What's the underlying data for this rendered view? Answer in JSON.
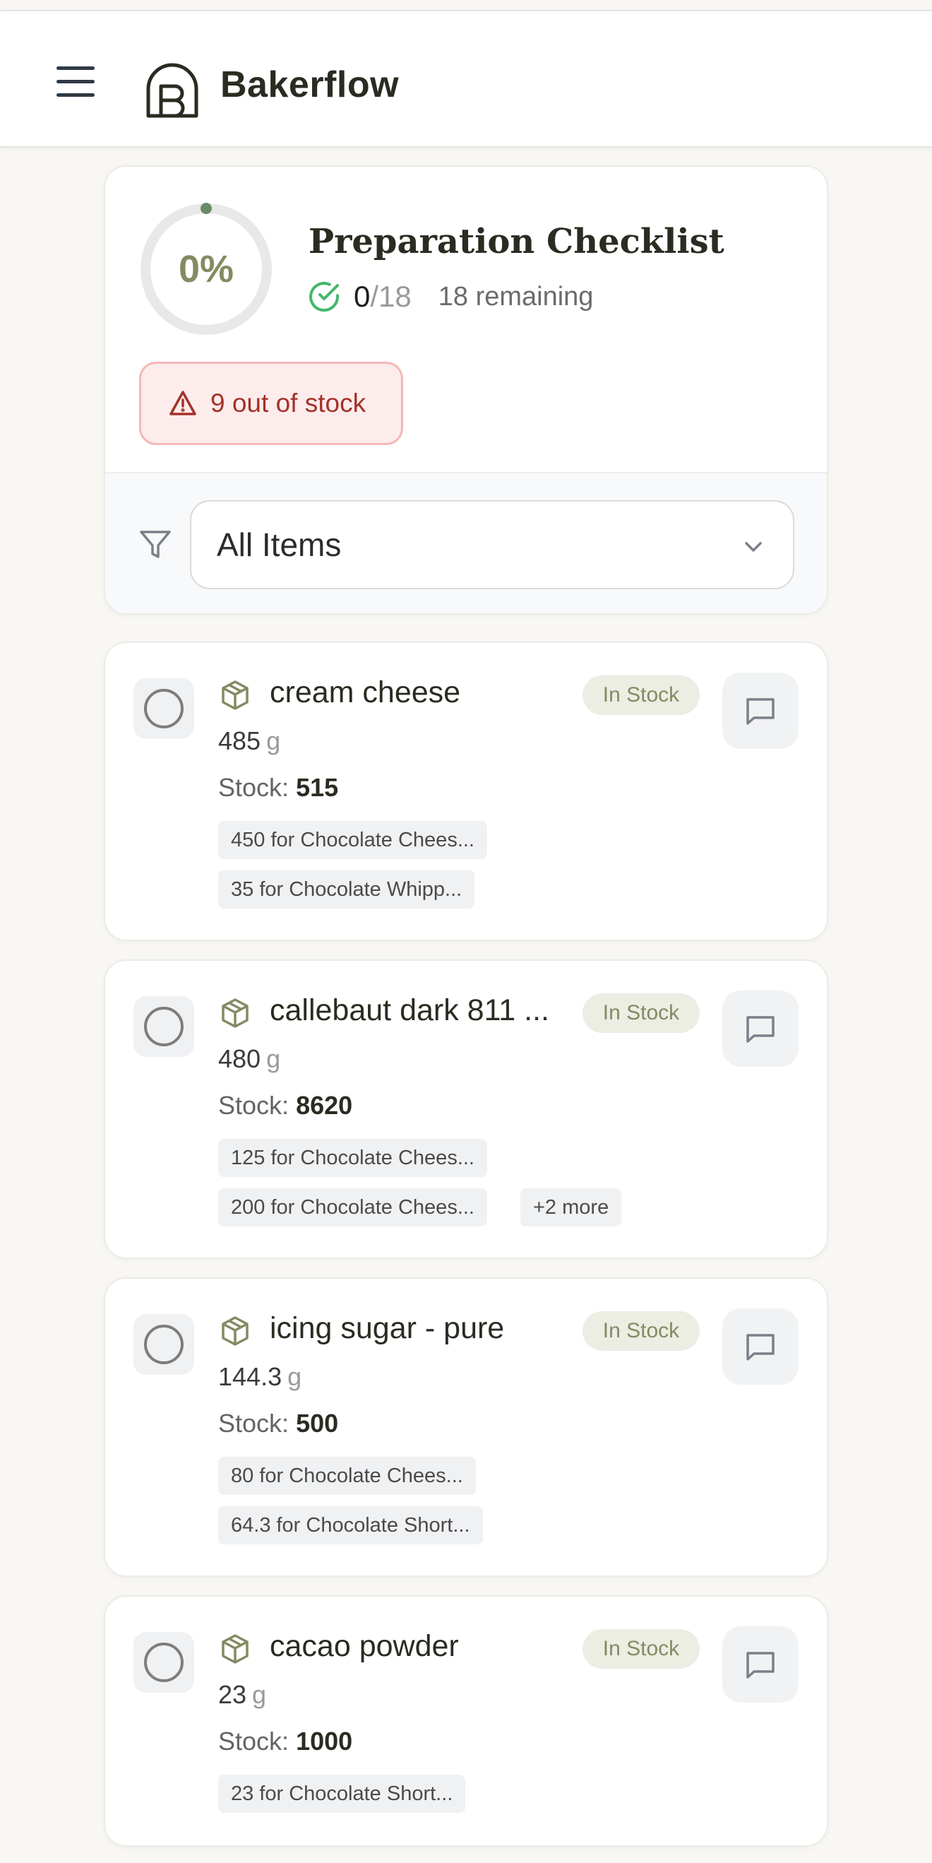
{
  "header": {
    "app_name": "Bakerflow",
    "menu_icon": "hamburger-menu-icon",
    "logo_icon": "bakerflow-logo"
  },
  "checklist": {
    "title": "Preparation Checklist",
    "progress_percent": "0%",
    "progress_fraction": 0,
    "completed": "0",
    "total": "/18",
    "remaining": "18 remaining",
    "out_of_stock": "9 out of stock",
    "filter": {
      "selected": "All Items"
    }
  },
  "colors": {
    "accent": "#838b62",
    "ring_track": "#e8e8e8",
    "ring_dot": "#6b8a6a",
    "success": "#43b86a",
    "danger": "#a23228",
    "danger_bg": "#fdecec"
  },
  "items": [
    {
      "name": "cream cheese",
      "status": "In Stock",
      "quantity": "485",
      "unit": "g",
      "stock_label": "Stock:",
      "stock": "515",
      "tags": [
        "450 for Chocolate Chees...",
        "35 for Chocolate Whipp..."
      ]
    },
    {
      "name": "callebaut dark 811 ...",
      "status": "In Stock",
      "quantity": "480",
      "unit": "g",
      "stock_label": "Stock:",
      "stock": "8620",
      "tags": [
        "125 for Chocolate Chees...",
        "200 for Chocolate Chees...",
        "+2 more"
      ]
    },
    {
      "name": "icing sugar - pure",
      "status": "In Stock",
      "quantity": "144.3",
      "unit": "g",
      "stock_label": "Stock:",
      "stock": "500",
      "tags": [
        "80 for Chocolate Chees...",
        "64.3 for Chocolate Short..."
      ]
    },
    {
      "name": "cacao powder",
      "status": "In Stock",
      "quantity": "23",
      "unit": "g",
      "stock_label": "Stock:",
      "stock": "1000",
      "tags": [
        "23 for Chocolate Short..."
      ]
    }
  ]
}
